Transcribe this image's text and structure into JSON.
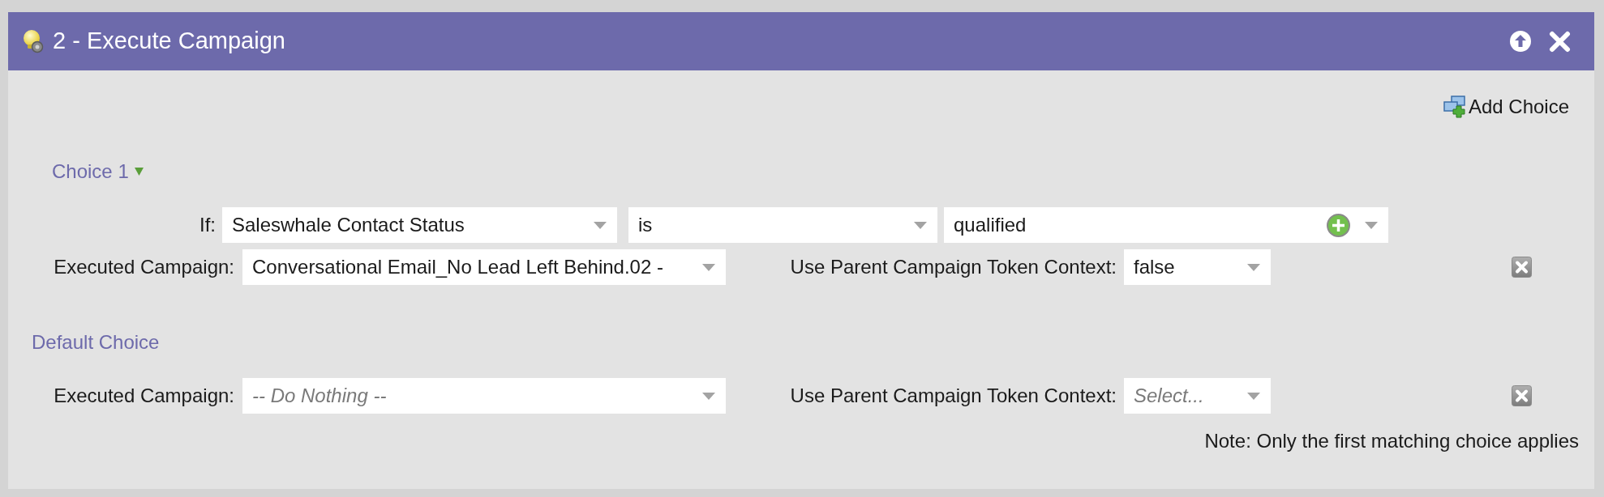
{
  "panel": {
    "title": "2 - Execute Campaign"
  },
  "add_choice": {
    "label": "Add Choice"
  },
  "choices": [
    {
      "title": "Choice 1",
      "condition": {
        "label": "If:",
        "attribute": {
          "value": "Saleswhale Contact Status"
        },
        "operator": {
          "value": "is"
        },
        "values": {
          "value": "qualified"
        }
      },
      "executed_campaign": {
        "label": "Executed Campaign:",
        "value": "Conversational Email_No Lead Left Behind.02 -"
      },
      "token_context": {
        "label": "Use Parent Campaign Token Context:",
        "value": "false"
      }
    }
  ],
  "default_choice": {
    "title": "Default Choice",
    "executed_campaign": {
      "label": "Executed Campaign:",
      "placeholder": "-- Do Nothing --"
    },
    "token_context": {
      "label": "Use Parent Campaign Token Context:",
      "placeholder": "Select..."
    }
  },
  "note": "Note: Only the first matching choice applies"
}
